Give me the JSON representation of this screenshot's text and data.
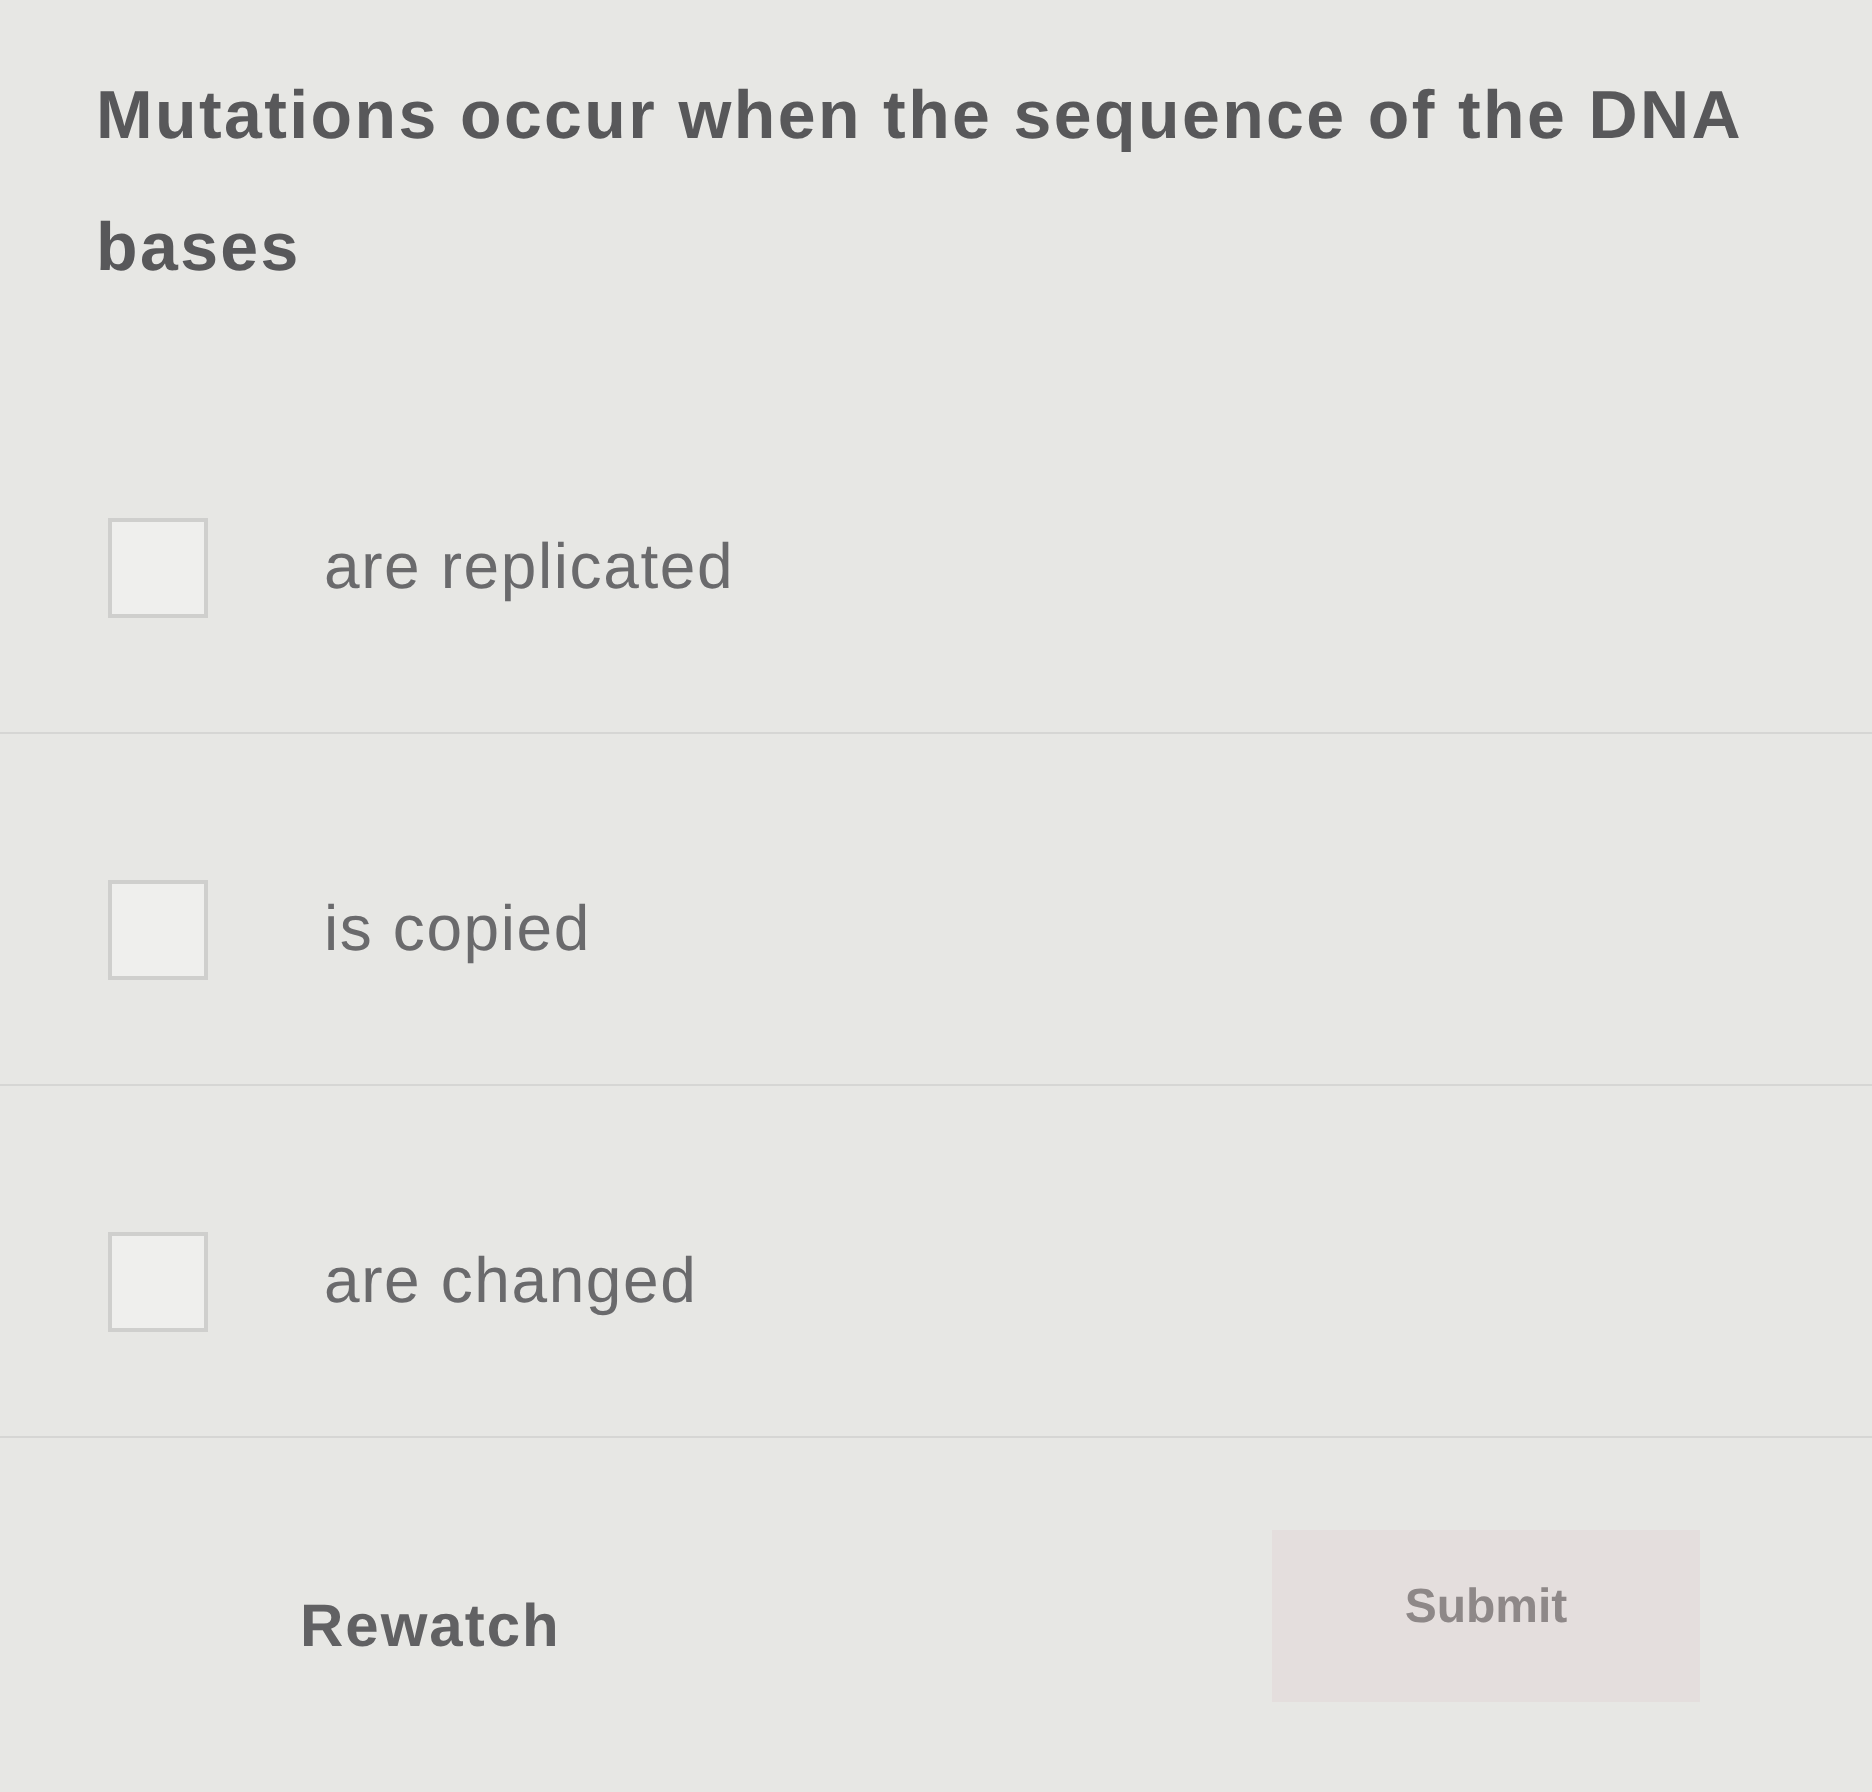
{
  "question": {
    "text": "Mutations occur when the sequence of the DNA bases"
  },
  "options": [
    {
      "label": "are replicated",
      "checked": false
    },
    {
      "label": "is copied",
      "checked": false
    },
    {
      "label": "are changed",
      "checked": false
    }
  ],
  "actions": {
    "rewatch": {
      "label": "Rewatch"
    },
    "submit": {
      "label": "Submit",
      "disabled": true
    }
  }
}
